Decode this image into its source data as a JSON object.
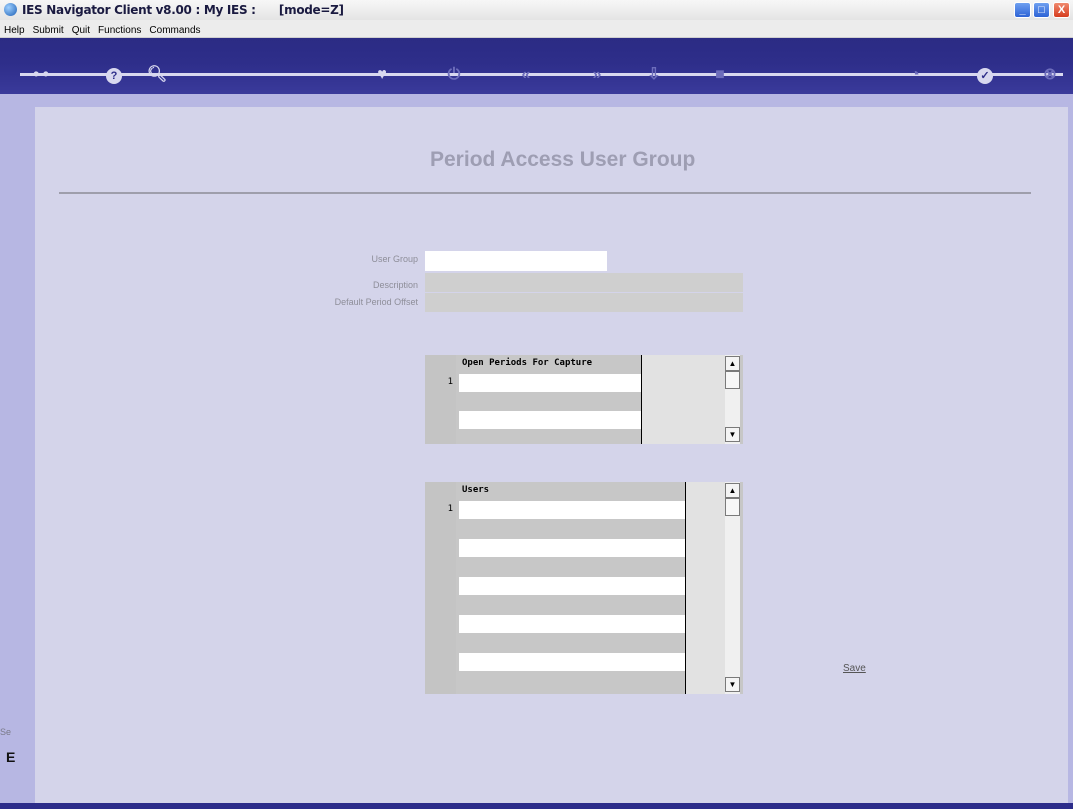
{
  "window": {
    "title": "IES Navigator Client v8.00 : My IES :      [mode=Z]",
    "controls": {
      "minimize": "_",
      "maximize": "□",
      "close": "X"
    }
  },
  "menu": [
    "Help",
    "Submit",
    "Quit",
    "Functions",
    "Commands"
  ],
  "toolbar": {
    "icons": [
      "key-icon",
      "help-icon",
      "search-icon",
      "heart-icon",
      "power-icon",
      "previous-icon",
      "next-icon",
      "download-icon",
      "stop-icon",
      "dashboard-icon",
      "accept-icon",
      "close-icon"
    ]
  },
  "form": {
    "title": "Period Access User Group",
    "fields": {
      "user_group": {
        "label": "User Group",
        "value": ""
      },
      "description": {
        "label": "Description",
        "value": ""
      },
      "default_period_offset": {
        "label": "Default Period Offset",
        "value": ""
      }
    },
    "open_periods_grid": {
      "header": "Open Periods For Capture",
      "row_numbers": [
        "1"
      ]
    },
    "users_grid": {
      "header": "Users",
      "row_numbers": [
        "1"
      ]
    },
    "save_label": "Save"
  },
  "left_strip": {
    "status_text": "Se",
    "status_text2": "E"
  }
}
